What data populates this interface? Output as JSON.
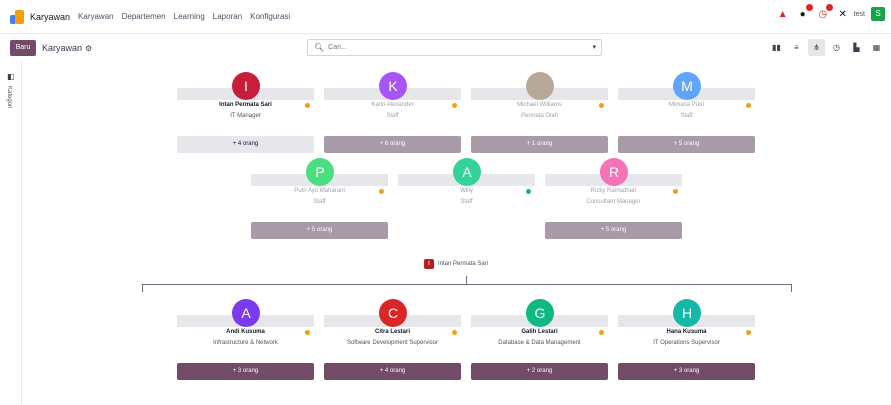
{
  "navbar": {
    "app_name": "Karyawan",
    "menu": [
      "Karyawan",
      "Departemen",
      "Learning",
      "Laporan",
      "Konfigurasi"
    ],
    "company": "test",
    "user_initial": "S"
  },
  "control_panel": {
    "new_label": "Baru",
    "breadcrumb": "Karyawan",
    "search_placeholder": "Cari..."
  },
  "sidepanel": {
    "label": "Kategori"
  },
  "org_chart": {
    "colleagues_row1": [
      {
        "initial": "I",
        "name": "Intan Permata Sari",
        "job": "IT Manager",
        "count": "+ 4 orang",
        "color": "#c81e3a",
        "status": "selected"
      },
      {
        "initial": "K",
        "name": "Karin Alexander",
        "job": "Staff",
        "count": "+ 6 orang",
        "color": "#a855f7",
        "status": "faded"
      },
      {
        "initial": "",
        "name": "Michael Williams",
        "job": "Permata Olah",
        "count": "+ 1 orang",
        "color": "#b8a89a",
        "status": "faded"
      },
      {
        "initial": "M",
        "name": "Mimasa Putri",
        "job": "Staff",
        "count": "+ 5 orang",
        "color": "#60a5fa",
        "status": "faded"
      }
    ],
    "colleagues_row2": [
      {
        "initial": "P",
        "name": "Putri Ayu Maharani",
        "job": "Staff",
        "count": "+ 5 orang",
        "color": "#4ade80",
        "status": "faded"
      },
      {
        "initial": "A",
        "name": "Willy",
        "job": "Staff",
        "count": "",
        "color": "#34d399",
        "status": "faded",
        "dot": "#10b981"
      },
      {
        "initial": "R",
        "name": "Rizky Ramadhan",
        "job": "Consultant Manager",
        "count": "+ 5 orang",
        "color": "#f472b6",
        "status": "faded"
      }
    ],
    "manager": {
      "initial": "I",
      "name": "Intan Permata Sari"
    },
    "reports": [
      {
        "initial": "A",
        "name": "Andi Kusuma",
        "job": "Infrastructure & Network",
        "count": "+ 3 orang",
        "color": "#7c3aed"
      },
      {
        "initial": "C",
        "name": "Citra Lestari",
        "job": "Software Development Supervisor",
        "count": "+ 4 orang",
        "color": "#dc2626"
      },
      {
        "initial": "G",
        "name": "Galih Lestari",
        "job": "Database & Data Management",
        "count": "+ 2 orang",
        "color": "#10b981"
      },
      {
        "initial": "H",
        "name": "Hana Kusuma",
        "job": "IT Operations Supervisor",
        "count": "+ 3 orang",
        "color": "#14b8a6"
      }
    ]
  }
}
